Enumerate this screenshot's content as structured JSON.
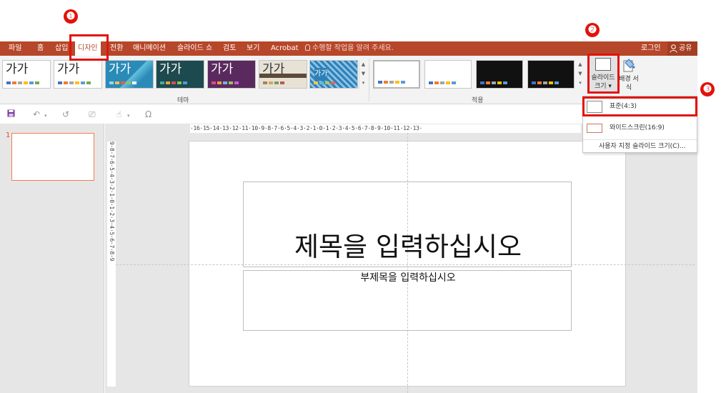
{
  "callouts": [
    "❶",
    "❷",
    "❸"
  ],
  "tabs": [
    {
      "label": "파일",
      "active": false
    },
    {
      "label": "홈",
      "active": false
    },
    {
      "label": "삽입",
      "active": false
    },
    {
      "label": "디자인",
      "active": true
    },
    {
      "label": "전환",
      "active": false
    },
    {
      "label": "애니메이션",
      "active": false
    },
    {
      "label": "슬라이드 쇼",
      "active": false
    },
    {
      "label": "검토",
      "active": false
    },
    {
      "label": "보기",
      "active": false
    },
    {
      "label": "Acrobat",
      "active": false
    }
  ],
  "tell_me": "수행할 작업을 알려 주세요.",
  "sign_in": "로그인",
  "share": "공유",
  "themes": {
    "group_label": "테마",
    "items": [
      {
        "label": "가가",
        "bg": "#ffffff",
        "text": "#222222"
      },
      {
        "label": "가가",
        "bg": "#ffffff",
        "text": "#222222"
      },
      {
        "label": "가가",
        "bg": "#2a8bb8",
        "text": "#ffffff"
      },
      {
        "label": "가가",
        "bg": "#1d4a4e",
        "text": "#ffffff"
      },
      {
        "label": "가가",
        "bg": "#5a2a5e",
        "text": "#ffffff"
      },
      {
        "label": "가가",
        "bg": "#e8e2d6",
        "text": "#333333"
      },
      {
        "label": "가가",
        "bg": "#2f80b8",
        "text": "#ffffff"
      }
    ]
  },
  "variants": {
    "group_label": "적용",
    "items": [
      {
        "bg": "#ffffff"
      },
      {
        "bg": "#ffffff"
      },
      {
        "bg": "#111111"
      },
      {
        "bg": "#111111"
      }
    ]
  },
  "customize": {
    "slide_size_label": "슬라이드 크기 ▾",
    "format_background_label": "배경 서식"
  },
  "slide_size_menu": {
    "standard": "표준(4:3)",
    "widescreen": "와이드스크린(16:9)",
    "custom": "사용자 지정 슬라이드 크기(C)..."
  },
  "thumbnail": {
    "number": "1"
  },
  "rulers": {
    "horizontal": "·16·15·14·13·12·11·10·9·8·7·6·5·4·3·2·1·0·1·2·3·4·5·6·7·8·9·10·11·12·13·",
    "vertical": "9·8·7·6·5·4·3·2·1·0·1·2·3·4·5·6·7·8·9"
  },
  "slide": {
    "title_placeholder": "제목을 입력하십시오",
    "subtitle_placeholder": "부제목을 입력하십시오"
  },
  "colors": {
    "ribbon_accent": "#b7472a",
    "callout": "#e3120b"
  }
}
